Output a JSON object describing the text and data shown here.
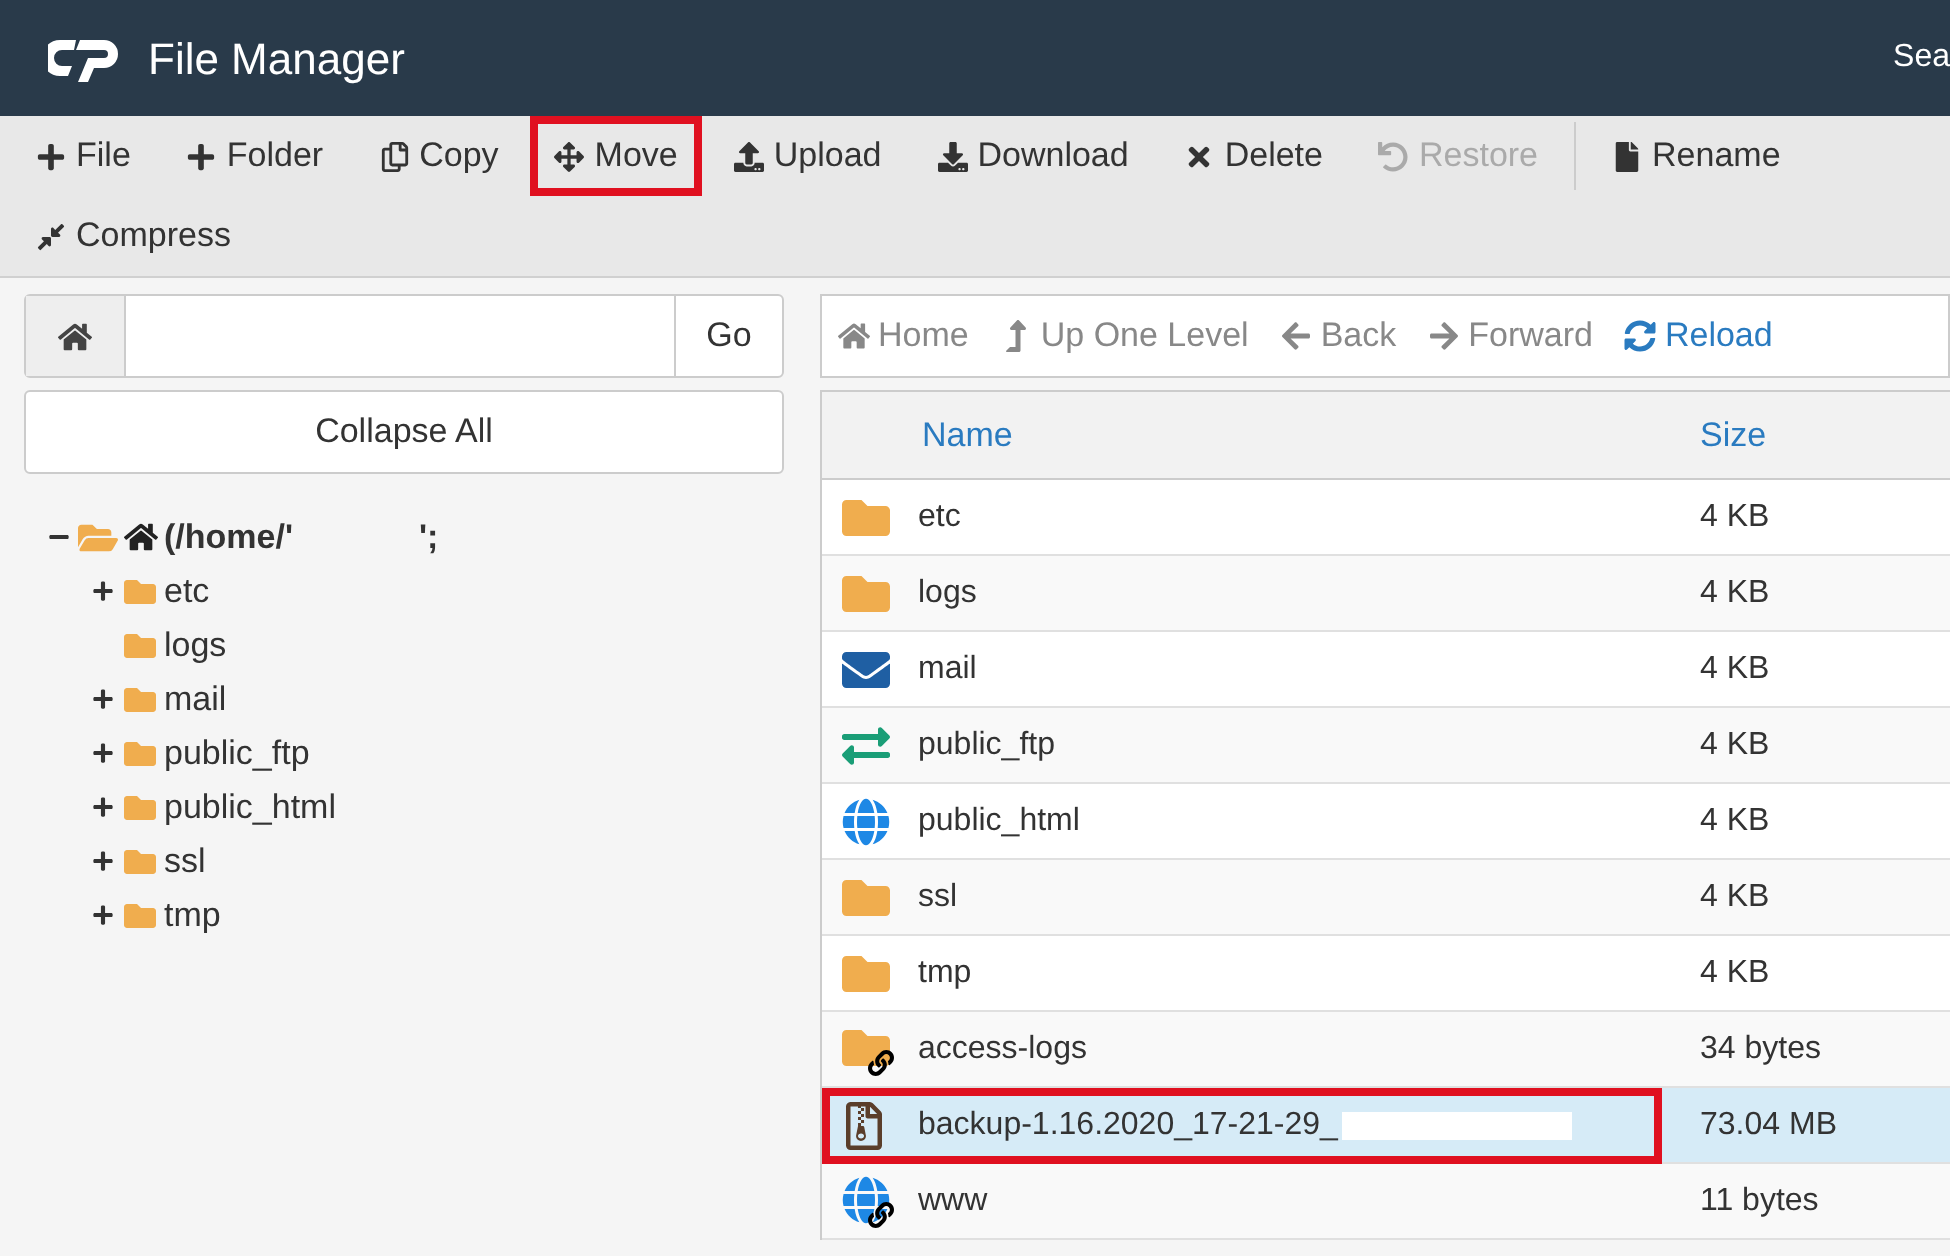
{
  "header": {
    "title": "File Manager",
    "search_label": "Sea"
  },
  "toolbar": [
    {
      "kind": "plus",
      "label": "File",
      "disabled": false,
      "highlighted": false
    },
    {
      "kind": "plus",
      "label": "Folder",
      "disabled": false,
      "highlighted": false
    },
    {
      "kind": "copy",
      "label": "Copy",
      "disabled": false,
      "highlighted": false
    },
    {
      "kind": "move",
      "label": "Move",
      "disabled": false,
      "highlighted": true
    },
    {
      "kind": "upload",
      "label": "Upload",
      "disabled": false,
      "highlighted": false
    },
    {
      "kind": "download",
      "label": "Download",
      "disabled": false,
      "highlighted": false
    },
    {
      "kind": "delete",
      "label": "Delete",
      "disabled": false,
      "highlighted": false
    },
    {
      "kind": "restore",
      "label": "Restore",
      "disabled": true,
      "highlighted": false
    },
    {
      "kind": "rename",
      "label": "Rename",
      "disabled": false,
      "highlighted": false
    },
    {
      "kind": "compress",
      "label": "Compress",
      "disabled": false,
      "highlighted": false
    }
  ],
  "path_bar": {
    "go": "Go"
  },
  "collapse_all": "Collapse All",
  "tree": {
    "label": "(/home/'",
    "suffix": "';",
    "expanded": true,
    "children": [
      {
        "label": "etc",
        "expandable": true
      },
      {
        "label": "logs",
        "expandable": false
      },
      {
        "label": "mail",
        "expandable": true
      },
      {
        "label": "public_ftp",
        "expandable": true
      },
      {
        "label": "public_html",
        "expandable": true
      },
      {
        "label": "ssl",
        "expandable": true
      },
      {
        "label": "tmp",
        "expandable": true
      }
    ]
  },
  "nav": [
    {
      "kind": "home",
      "label": "Home",
      "active": false
    },
    {
      "kind": "up",
      "label": "Up One Level",
      "active": false
    },
    {
      "kind": "back",
      "label": "Back",
      "active": false
    },
    {
      "kind": "forward",
      "label": "Forward",
      "active": false
    },
    {
      "kind": "reload",
      "label": "Reload",
      "active": true
    }
  ],
  "table": {
    "columns": [
      "Name",
      "Size"
    ],
    "rows": [
      {
        "kind": "folder",
        "name": "etc",
        "size": "4 KB",
        "selected": false,
        "highlighted": false
      },
      {
        "kind": "folder",
        "name": "logs",
        "size": "4 KB",
        "selected": false,
        "highlighted": false
      },
      {
        "kind": "mail",
        "name": "mail",
        "size": "4 KB",
        "selected": false,
        "highlighted": false
      },
      {
        "kind": "ftp",
        "name": "public_ftp",
        "size": "4 KB",
        "selected": false,
        "highlighted": false
      },
      {
        "kind": "web",
        "name": "public_html",
        "size": "4 KB",
        "selected": false,
        "highlighted": false
      },
      {
        "kind": "folder",
        "name": "ssl",
        "size": "4 KB",
        "selected": false,
        "highlighted": false
      },
      {
        "kind": "folder",
        "name": "tmp",
        "size": "4 KB",
        "selected": false,
        "highlighted": false
      },
      {
        "kind": "folder-link",
        "name": "access-logs",
        "size": "34 bytes",
        "selected": false,
        "highlighted": false
      },
      {
        "kind": "archive",
        "name": "backup-1.16.2020_17-21-29_",
        "size": "73.04 MB",
        "selected": true,
        "highlighted": true,
        "redacted": true
      },
      {
        "kind": "web-link",
        "name": "www",
        "size": "11 bytes",
        "selected": false,
        "highlighted": false
      }
    ]
  }
}
